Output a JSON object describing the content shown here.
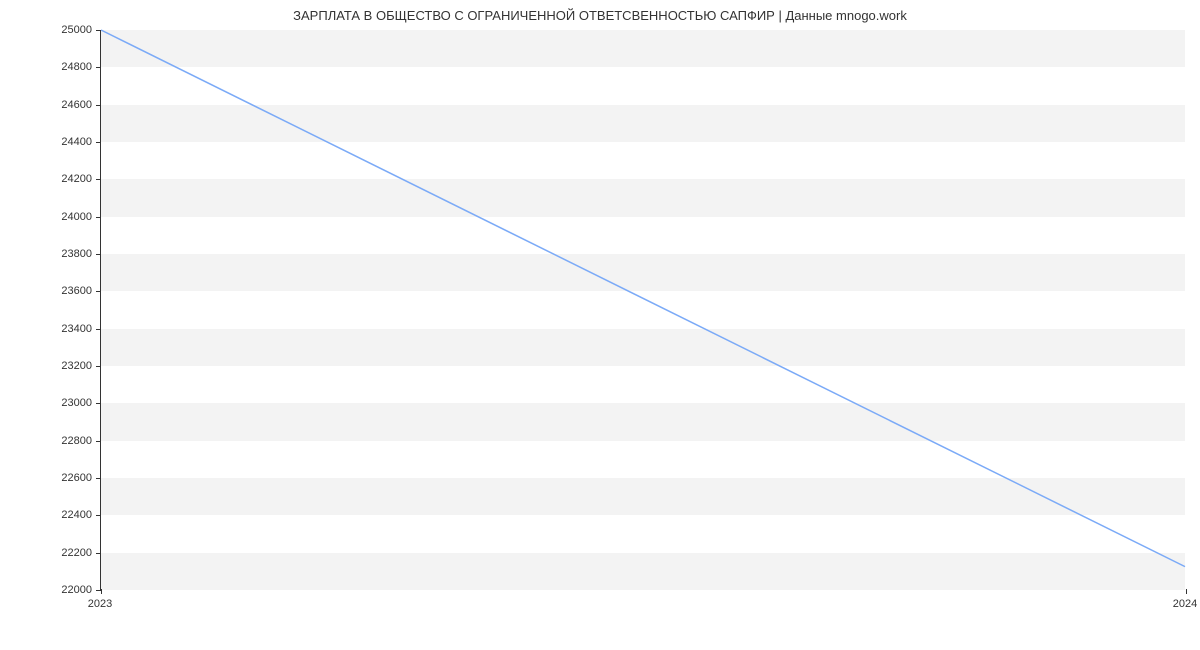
{
  "chart_data": {
    "type": "line",
    "title": "ЗАРПЛАТА В ОБЩЕСТВО С ОГРАНИЧЕННОЙ ОТВЕТСВЕННОСТЬЮ САПФИР | Данные mnogo.work",
    "xlabel": "",
    "ylabel": "",
    "x_categories": [
      "2023",
      "2024"
    ],
    "series": [
      {
        "name": "salary",
        "values": [
          25000,
          22120
        ]
      }
    ],
    "ylim": [
      22000,
      25000
    ],
    "xlim_index": [
      0,
      1
    ],
    "y_ticks": [
      22000,
      22200,
      22400,
      22600,
      22800,
      23000,
      23200,
      23400,
      23600,
      23800,
      24000,
      24200,
      24400,
      24600,
      24800,
      25000
    ],
    "bands": true,
    "line_color": "#7baaf7"
  }
}
